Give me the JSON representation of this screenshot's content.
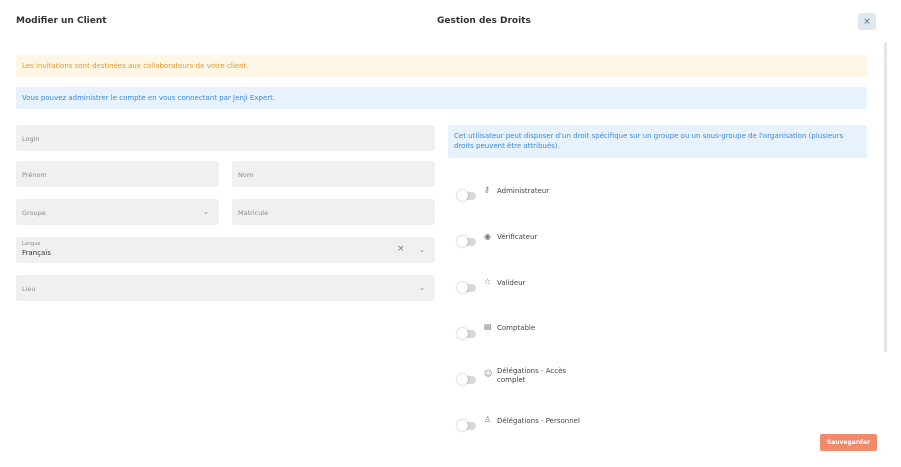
{
  "header": {
    "left_title": "Modifier un Client",
    "center_title": "Gestion des Droits",
    "close_label": "×"
  },
  "alerts": {
    "warning": "Les invitations sont destinées aux collaborateurs de votre client.",
    "info": "Vous pouvez administrer le compte en vous connectant par Jenji Expert."
  },
  "form": {
    "login_label": "Login",
    "prenom_label": "Prénom",
    "nom_label": "Nom",
    "groupe_label": "Groupe",
    "matricule_label": "Matricule",
    "langue_label": "Langue",
    "langue_value": "Français",
    "lieu_label": "Lieu",
    "clear_icon": "×",
    "chevron": "⌄"
  },
  "rights": {
    "info": "Cet utilisateur peut disposer d'un droit spécifique sur un groupe ou un sous-groupe de l'organisation (plusieurs droits peuvent être attribués).",
    "items": [
      {
        "label": "Administrateur",
        "icon": "key-icon",
        "glyph": "⚷",
        "enabled": false
      },
      {
        "label": "Vérificateur",
        "icon": "eye-icon",
        "glyph": "◉",
        "enabled": false
      },
      {
        "label": "Valideur",
        "icon": "star-icon",
        "glyph": "☆",
        "enabled": false
      },
      {
        "label": "Comptable",
        "icon": "ledger-icon",
        "glyph": "▤",
        "enabled": false
      },
      {
        "label": "Délégations - Accès complet",
        "label_line1": "Délégations - Accès",
        "label_line2": "complet",
        "icon": "users-icon",
        "glyph": "☺",
        "enabled": false
      },
      {
        "label": "Délégations - Personnel",
        "icon": "person-icon",
        "glyph": "♙",
        "enabled": false
      }
    ]
  },
  "footer": {
    "save_label": "Sauvegarder"
  },
  "colors": {
    "warning_bg": "#fff6e6",
    "warning_text": "#e59a2a",
    "info_bg": "#e8f2fd",
    "info_text": "#3a8ad8",
    "save_bg": "#f08a6a"
  }
}
